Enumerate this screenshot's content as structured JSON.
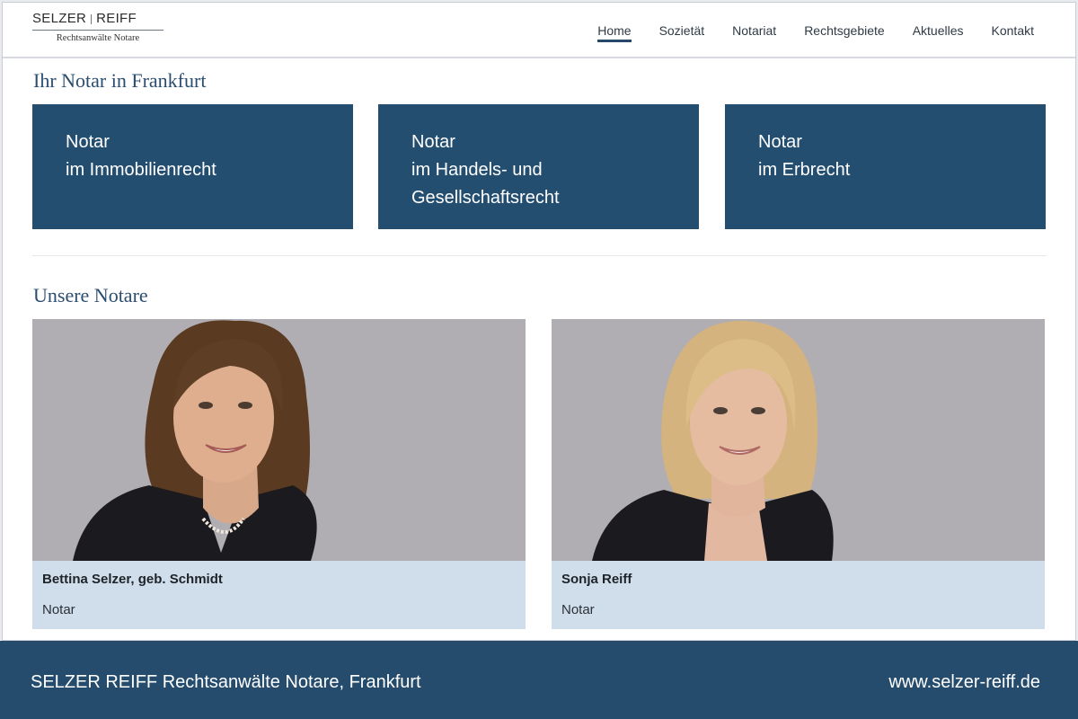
{
  "logo": {
    "name_left": "SELZER",
    "name_right": "REIFF",
    "subtitle": "Rechtsanwälte Notare"
  },
  "nav": {
    "items": [
      {
        "label": "Home",
        "active": true
      },
      {
        "label": "Sozietät"
      },
      {
        "label": "Notariat"
      },
      {
        "label": "Rechtsgebiete"
      },
      {
        "label": "Aktuelles"
      },
      {
        "label": "Kontakt"
      }
    ]
  },
  "intro": {
    "heading": "Ihr Notar in Frankfurt",
    "tiles": [
      {
        "line1": "Notar",
        "line2": "im Immobilienrecht",
        "line3": ""
      },
      {
        "line1": "Notar",
        "line2": "im Handels- und",
        "line3": "Gesellschaftsrecht"
      },
      {
        "line1": "Notar",
        "line2": "im Erbrecht",
        "line3": ""
      }
    ]
  },
  "team": {
    "heading": "Unsere Notare",
    "members": [
      {
        "name": "Bettina Selzer, geb. Schmidt",
        "role": "Notar"
      },
      {
        "name": "Sonja Reiff",
        "role": "Notar"
      }
    ]
  },
  "footer": {
    "left": "SELZER REIFF Rechtsanwälte Notare, Frankfurt",
    "right": "www.selzer-reiff.de"
  },
  "colors": {
    "primary": "#244e70",
    "card_bg": "#d0deec",
    "photo_bg": "#b0adb3",
    "heading": "#2a4d70"
  }
}
